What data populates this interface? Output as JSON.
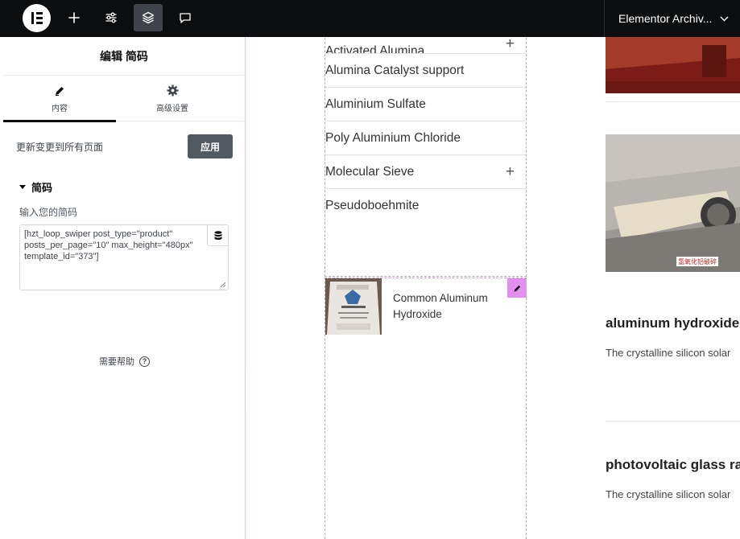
{
  "topbar": {
    "site_name": "Elementor Archiv...",
    "icons": [
      "elementor-logo-icon",
      "plus-icon",
      "sliders-icon",
      "layers-icon",
      "chat-icon",
      "chevron-down-icon"
    ]
  },
  "panel": {
    "title": "编辑 简码",
    "tabs": [
      {
        "label": "内容",
        "icon": "pencil-icon"
      },
      {
        "label": "高级设置",
        "icon": "gear-icon"
      }
    ],
    "update_label": "更新变更到所有页面",
    "apply_label": "应用",
    "section_title": "简码",
    "field_label": "输入您的简码",
    "shortcode_value": "[hzt_loop_swiper post_type=\"product\" posts_per_page=\"10\" max_height=\"480px\" template_id=\"373\"]",
    "help_label": "需要帮助"
  },
  "canvas": {
    "menu_items": [
      {
        "label": "Activated Alumina",
        "has_plus": true
      },
      {
        "label": "Alumina Catalyst support",
        "has_plus": false
      },
      {
        "label": "Aluminium Sulfate",
        "has_plus": false
      },
      {
        "label": "Poly Aluminium Chloride",
        "has_plus": false
      },
      {
        "label": "Molecular Sieve",
        "has_plus": true
      },
      {
        "label": "Pseudoboehmite",
        "has_plus": false
      }
    ],
    "product": {
      "name": "Common Aluminum Hydroxide"
    },
    "posts": [
      {
        "title": "aluminum hydroxide",
        "excerpt": "The crystalline silicon solar"
      },
      {
        "title": "photovoltaic glass ra",
        "excerpt": "The crystalline silicon solar"
      }
    ],
    "image_caption": "氢氧化铝破碎"
  },
  "colors": {
    "topbar_bg": "#0c0d0e",
    "active_tool_bg": "#3f444b",
    "apply_button_bg": "#515962",
    "edit_handle": "#e38fef"
  }
}
